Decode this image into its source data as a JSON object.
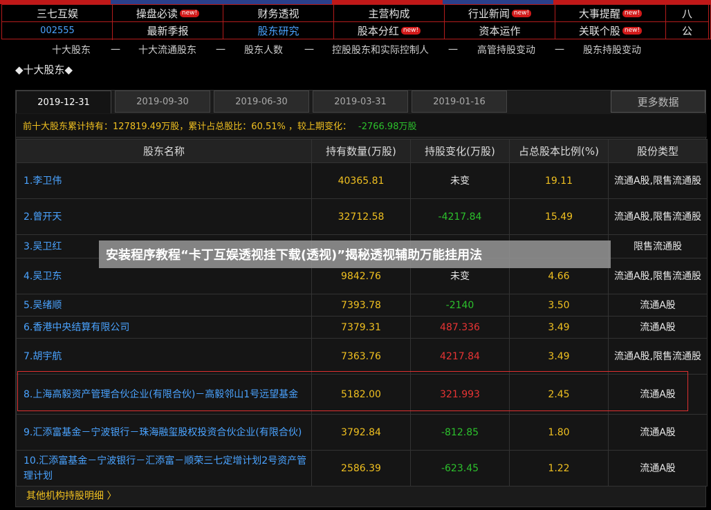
{
  "stock": {
    "name": "三七互娱",
    "code": "002555"
  },
  "nav": {
    "row1": [
      {
        "label": "操盘必读",
        "new": "new!"
      },
      {
        "label": "财务透视",
        "new": ""
      },
      {
        "label": "主营构成",
        "new": ""
      },
      {
        "label": "行业新闻",
        "new": "new!"
      },
      {
        "label": "大事提醒",
        "new": "new!"
      },
      {
        "label": "八",
        "new": ""
      }
    ],
    "row2": [
      {
        "label": "最新季报",
        "new": ""
      },
      {
        "label": "股东研究",
        "new": ""
      },
      {
        "label": "股本分红",
        "new": "new!"
      },
      {
        "label": "资本运作",
        "new": ""
      },
      {
        "label": "关联个股",
        "new": "new!"
      },
      {
        "label": "公",
        "new": ""
      }
    ]
  },
  "subnav": [
    "十大股东",
    "一",
    "十大流通股东",
    "一",
    "股东人数",
    "一",
    "控股股东和实际控制人",
    "一",
    "高管持股变动",
    "一",
    "股东持股变动"
  ],
  "section_title": "◆十大股东◆",
  "tabs": [
    "2019-12-31",
    "2019-09-30",
    "2019-06-30",
    "2019-03-31",
    "2019-01-16"
  ],
  "more_label": "更多数据",
  "summary": {
    "text": "前十大股东累计持有：127819.49万股，累计占总股比：60.51% ，较上期变化：",
    "change": "-2766.98万股"
  },
  "table": {
    "headers": [
      "股东名称",
      "持有数量(万股)",
      "持股变化(万股)",
      "占总股本比例(%)",
      "股份类型"
    ],
    "rows": [
      {
        "name": "1.李卫伟",
        "qty": "40365.81",
        "change": "未变",
        "dir": "same",
        "pct": "19.11",
        "type": "流通A股,限售流通股"
      },
      {
        "name": "2.曾开天",
        "qty": "32712.58",
        "change": "-4217.84",
        "dir": "down",
        "pct": "15.49",
        "type": "流通A股,限售流通股"
      },
      {
        "name": "3.吴卫红",
        "qty": "",
        "change": "",
        "dir": "same",
        "pct": "",
        "type": "限售流通股"
      },
      {
        "name": "4.吴卫东",
        "qty": "9842.76",
        "change": "未变",
        "dir": "same",
        "pct": "4.66",
        "type": "流通A股,限售流通股"
      },
      {
        "name": "5.吴绪顺",
        "qty": "7393.78",
        "change": "-2140",
        "dir": "down",
        "pct": "3.50",
        "type": "流通A股"
      },
      {
        "name": "6.香港中央结算有限公司",
        "qty": "7379.31",
        "change": "487.336",
        "dir": "up",
        "pct": "3.49",
        "type": "流通A股"
      },
      {
        "name": "7.胡宇航",
        "qty": "7363.76",
        "change": "4217.84",
        "dir": "up",
        "pct": "3.49",
        "type": "流通A股,限售流通股"
      },
      {
        "name": "8.上海高毅资产管理合伙企业(有限合伙)－高毅邻山1号远望基金",
        "qty": "5182.00",
        "change": "321.993",
        "dir": "up",
        "pct": "2.45",
        "type": "流通A股"
      },
      {
        "name": "9.汇添富基金－宁波银行－珠海融玺股权投资合伙企业(有限合伙)",
        "qty": "3792.84",
        "change": "-812.85",
        "dir": "down",
        "pct": "1.80",
        "type": "流通A股"
      },
      {
        "name": "10.汇添富基金－宁波银行－汇添富－顺荣三七定增计划2号资产管理计划",
        "qty": "2586.39",
        "change": "-623.45",
        "dir": "down",
        "pct": "1.22",
        "type": "流通A股"
      }
    ]
  },
  "footer_link": "其他机构持股明细 〉",
  "overlay_text": "安装程序教程“卡丁互娱透视挂下载(透视)”揭秘透视辅助万能挂用法",
  "colors": {
    "accent_red": "#b51c1c",
    "link_blue": "#4aa3ff",
    "value_yellow": "#f0c020",
    "up_red": "#e83434",
    "down_green": "#2cc12c"
  }
}
